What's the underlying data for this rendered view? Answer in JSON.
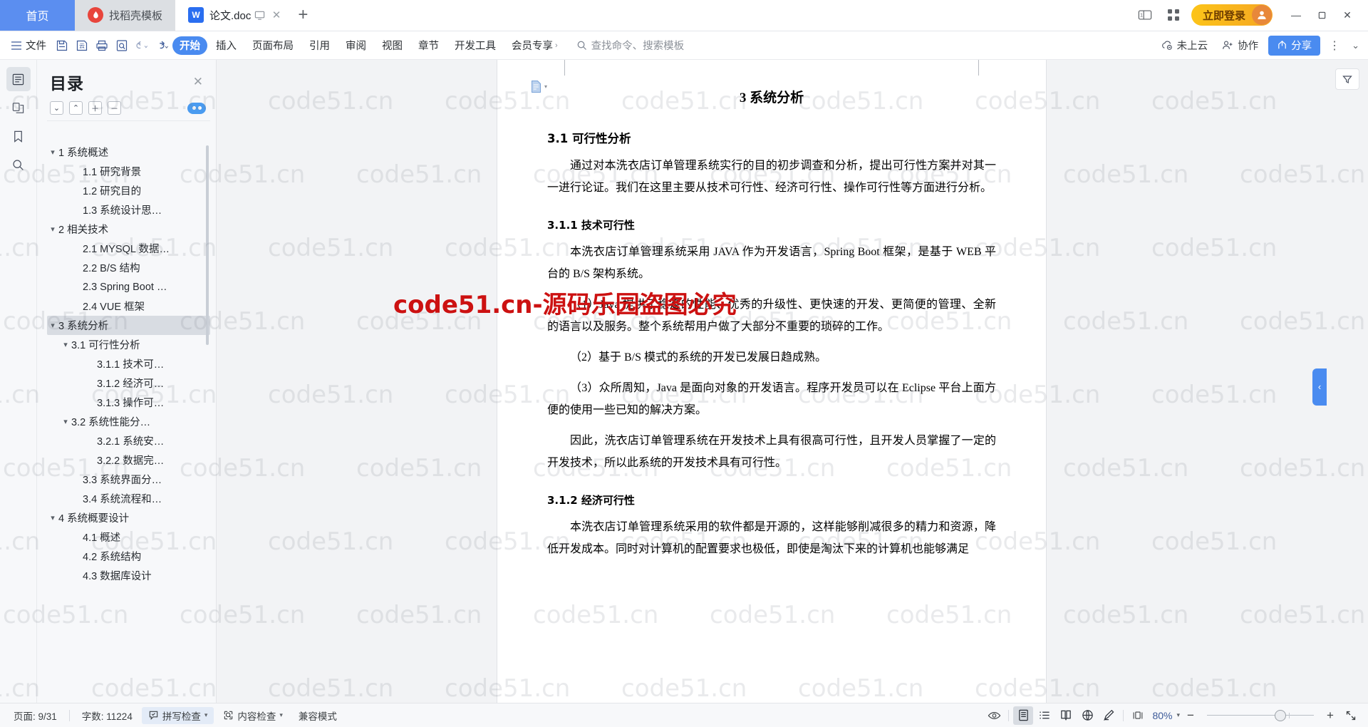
{
  "window": {
    "tabs": [
      {
        "label": "首页",
        "type": "home",
        "icon": "home-tab"
      },
      {
        "label": "找稻壳模板",
        "type": "inactive",
        "icon": "daoke-icon"
      },
      {
        "label": "论文.doc",
        "type": "active",
        "icon": "wps-writer-icon"
      }
    ],
    "new_tab_label": "+",
    "login_label": "立即登录",
    "controls": {
      "minimize": "—",
      "maximize": "▢",
      "close": "✕"
    }
  },
  "ribbon": {
    "menu_label": "文件",
    "tabs": [
      {
        "label": "开始",
        "active": true
      },
      {
        "label": "插入",
        "active": false
      },
      {
        "label": "页面布局",
        "active": false
      },
      {
        "label": "引用",
        "active": false
      },
      {
        "label": "审阅",
        "active": false
      },
      {
        "label": "视图",
        "active": false
      },
      {
        "label": "章节",
        "active": false
      },
      {
        "label": "开发工具",
        "active": false
      },
      {
        "label": "会员专享",
        "active": false
      }
    ],
    "search_placeholder": "查找命令、搜索模板",
    "cloud_status": "未上云",
    "collaborate_label": "协作",
    "share_label": "分享"
  },
  "toc": {
    "title": "目录",
    "close_label": "✕",
    "tools": [
      "collapse-down",
      "collapse-up",
      "expand-all",
      "collapse-all"
    ],
    "items": [
      {
        "label": "1 系统概述",
        "level": 1,
        "caret": "▾",
        "selected": false
      },
      {
        "label": "1.1  研究背景",
        "level": 2,
        "caret": "",
        "selected": false
      },
      {
        "label": "1.2 研究目的",
        "level": 2,
        "caret": "",
        "selected": false
      },
      {
        "label": "1.3 系统设计思…",
        "level": 2,
        "caret": "",
        "selected": false
      },
      {
        "label": "2 相关技术",
        "level": 1,
        "caret": "▾",
        "selected": false
      },
      {
        "label": "2.1 MYSQL 数据…",
        "level": 2,
        "caret": "",
        "selected": false
      },
      {
        "label": "2.2 B/S 结构",
        "level": 2,
        "caret": "",
        "selected": false
      },
      {
        "label": "2.3 Spring Boot …",
        "level": 2,
        "caret": "",
        "selected": false
      },
      {
        "label": "2.4 VUE 框架",
        "level": 2,
        "caret": "",
        "selected": false
      },
      {
        "label": "3 系统分析",
        "level": 1,
        "caret": "▾",
        "selected": true
      },
      {
        "label": "3.1 可行性分析",
        "level": "2c",
        "caret": "▾",
        "selected": false
      },
      {
        "label": "3.1.1 技术可…",
        "level": 3,
        "caret": "",
        "selected": false
      },
      {
        "label": "3.1.2 经济可…",
        "level": 3,
        "caret": "",
        "selected": false
      },
      {
        "label": "3.1.3 操作可…",
        "level": 3,
        "caret": "",
        "selected": false
      },
      {
        "label": "3.2 系统性能分…",
        "level": "2c",
        "caret": "▾",
        "selected": false
      },
      {
        "label": "3.2.1  系统安…",
        "level": 3,
        "caret": "",
        "selected": false
      },
      {
        "label": "3.2.2  数据完…",
        "level": 3,
        "caret": "",
        "selected": false
      },
      {
        "label": "3.3 系统界面分…",
        "level": 2,
        "caret": "",
        "selected": false
      },
      {
        "label": "3.4 系统流程和…",
        "level": 2,
        "caret": "",
        "selected": false
      },
      {
        "label": "4 系统概要设计",
        "level": 1,
        "caret": "▾",
        "selected": false
      },
      {
        "label": "4.1 概述",
        "level": 2,
        "caret": "",
        "selected": false
      },
      {
        "label": "4.2 系统结构",
        "level": 2,
        "caret": "",
        "selected": false
      },
      {
        "label": "4.3 数据库设计",
        "level": 2,
        "caret": "",
        "selected": false
      }
    ]
  },
  "document": {
    "header": "3 系统分析",
    "blocks": [
      {
        "type": "h2",
        "text": "3.1 可行性分析"
      },
      {
        "type": "p",
        "text": "通过对本洗衣店订单管理系统实行的目的初步调查和分析，提出可行性方案并对其一一进行论证。我们在这里主要从技术可行性、经济可行性、操作可行性等方面进行分析。"
      },
      {
        "type": "h3",
        "text": "3.1.1 技术可行性"
      },
      {
        "type": "p",
        "text": "本洗衣店订单管理系统采用 JAVA 作为开发语言，Spring Boot 框架，是基于 WEB 平台的 B/S 架构系统。"
      },
      {
        "type": "p",
        "text": "（1）Java 提供了稳定的性能、优秀的升级性、更快速的开发、更简便的管理、全新的语言以及服务。整个系统帮用户做了大部分不重要的琐碎的工作。"
      },
      {
        "type": "p",
        "text": "（2）基于 B/S 模式的系统的开发已发展日趋成熟。"
      },
      {
        "type": "p",
        "text": "（3）众所周知，Java 是面向对象的开发语言。程序开发员可以在 Eclipse 平台上面方便的使用一些已知的解决方案。"
      },
      {
        "type": "p",
        "text": "因此，洗衣店订单管理系统在开发技术上具有很高可行性，且开发人员掌握了一定的开发技术，所以此系统的开发技术具有可行性。"
      },
      {
        "type": "h3",
        "text": "3.1.2 经济可行性"
      },
      {
        "type": "p",
        "text": "本洗衣店订单管理系统采用的软件都是开源的，这样能够削减很多的精力和资源，降低开发成本。同时对计算机的配置要求也极低，即使是淘汰下来的计算机也能够满足"
      }
    ]
  },
  "status": {
    "page_label": "页面: 9/31",
    "word_count_label": "字数: 11224",
    "spellcheck_label": "拼写检查",
    "contentcheck_label": "内容检查",
    "compat_label": "兼容模式",
    "zoom_label": "80%",
    "zoom_out": "−",
    "zoom_in": "+",
    "view_icons": [
      "eye-icon",
      "page-view-icon",
      "outline-view-icon",
      "reading-view-icon",
      "web-view-icon",
      "edit-view-icon",
      "fit-page-icon"
    ]
  },
  "watermark": {
    "tile_text": "code51.cn",
    "red_text": "code51.cn-源码乐园盗图必究"
  },
  "colors": {
    "accent": "#4a8bf0",
    "home_tab": "#5b8ef0",
    "login_gold": "#f5a623",
    "watermark_red": "#cc1111"
  }
}
